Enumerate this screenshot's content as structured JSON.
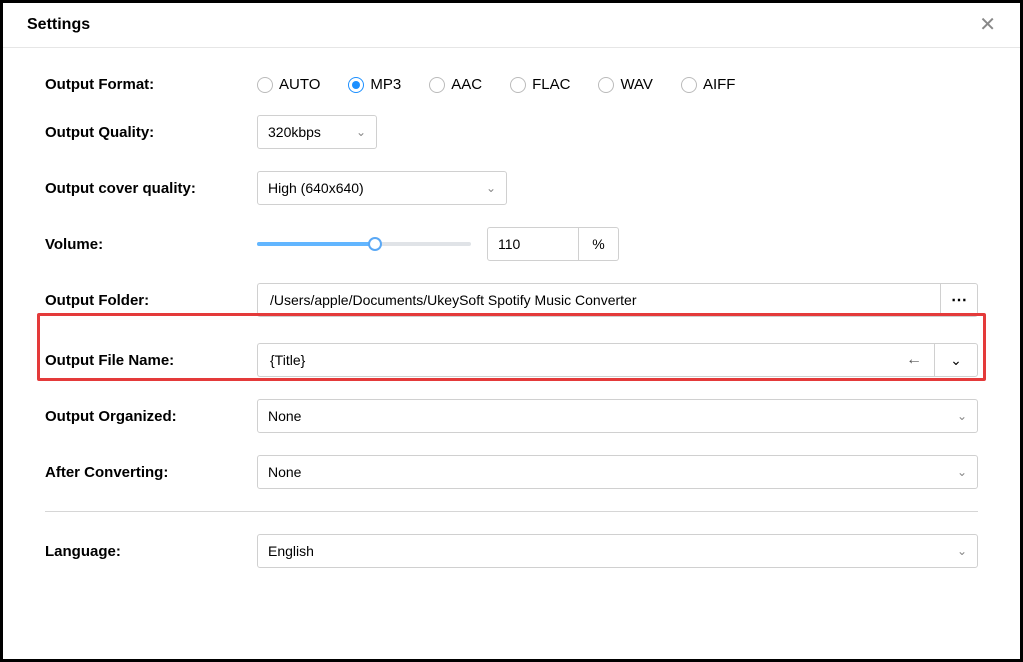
{
  "header": {
    "title": "Settings"
  },
  "labels": {
    "output_format": "Output Format:",
    "output_quality": "Output Quality:",
    "output_cover_quality": "Output cover quality:",
    "volume": "Volume:",
    "output_folder": "Output Folder:",
    "output_file_name": "Output File Name:",
    "output_organized": "Output Organized:",
    "after_converting": "After Converting:",
    "language": "Language:"
  },
  "output_format": {
    "options": [
      "AUTO",
      "MP3",
      "AAC",
      "FLAC",
      "WAV",
      "AIFF"
    ],
    "selected": "MP3",
    "opt0": "AUTO",
    "opt1": "MP3",
    "opt2": "AAC",
    "opt3": "FLAC",
    "opt4": "WAV",
    "opt5": "AIFF"
  },
  "output_quality": {
    "value": "320kbps"
  },
  "output_cover_quality": {
    "value": "High (640x640)"
  },
  "volume": {
    "value": "110",
    "percent": 55,
    "unit": "%"
  },
  "output_folder": {
    "path": "/Users/apple/Documents/UkeySoft Spotify Music Converter",
    "browse_label": "⋯"
  },
  "output_file_name": {
    "value": "{Title}"
  },
  "output_organized": {
    "value": "None"
  },
  "after_converting": {
    "value": "None"
  },
  "language": {
    "value": "English"
  }
}
